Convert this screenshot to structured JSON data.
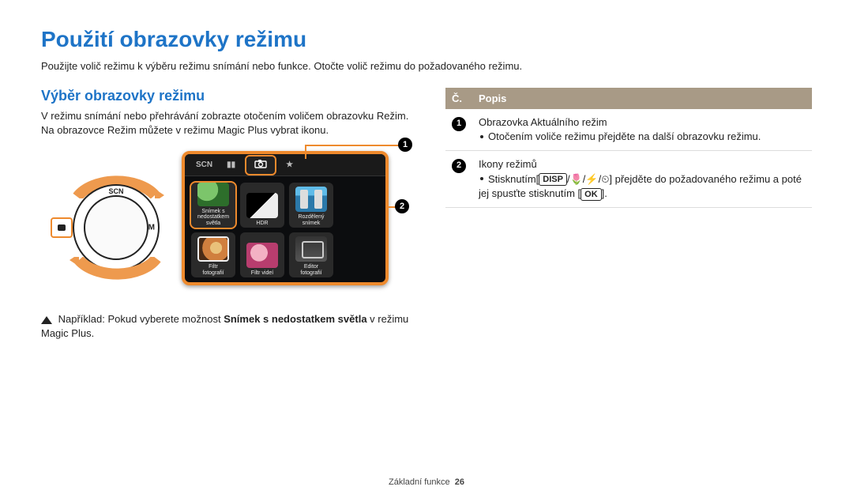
{
  "title": "Použití obrazovky režimu",
  "intro": "Použijte volič režimu k výběru režimu snímání nebo funkce. Otočte volič režimu do požadovaného režimu.",
  "left": {
    "subhead": "Výběr obrazovky režimu",
    "body1": "V režimu snímání nebo přehrávání zobrazte otočením voličem obrazovku Režim.",
    "body2": "Na obrazovce Režim můžete v režimu Magic Plus vybrat ikonu.",
    "dial_top": "SCN",
    "dial_right": "M",
    "screen_top_seg1": "SCN",
    "tiles": [
      {
        "label": "Snímek s\nnedostatkem světla"
      },
      {
        "label": "HDR"
      },
      {
        "label": "Rozdělený\nsnímek"
      },
      {
        "label": "Filtr\nfotografií"
      },
      {
        "label": "Filtr videí"
      },
      {
        "label": "Editor\nfotografií"
      }
    ],
    "example_prefix": "Například: Pokud vyberete možnost ",
    "example_bold": "Snímek s nedostatkem světla",
    "example_suffix": " v režimu Magic Plus.",
    "callout1": "1",
    "callout2": "2"
  },
  "right": {
    "head_no": "Č.",
    "head_desc": "Popis",
    "rows": [
      {
        "n": "1",
        "line1": "Obrazovka Aktuálního režim",
        "bullet1": "Otočením voliče režimu přejděte na další obrazovku režimu."
      },
      {
        "n": "2",
        "line1": "Ikony režimů",
        "bullet1_pre": "Stisknutím[",
        "key_disp": "DISP",
        "slash": "/",
        "bullet1_post": "] přejděte do požadovaného režimu a poté jej spusťte stisknutím [",
        "key_ok": "OK",
        "bullet1_end": "]."
      }
    ]
  },
  "footer": {
    "section": "Základní funkce",
    "page": "26"
  }
}
